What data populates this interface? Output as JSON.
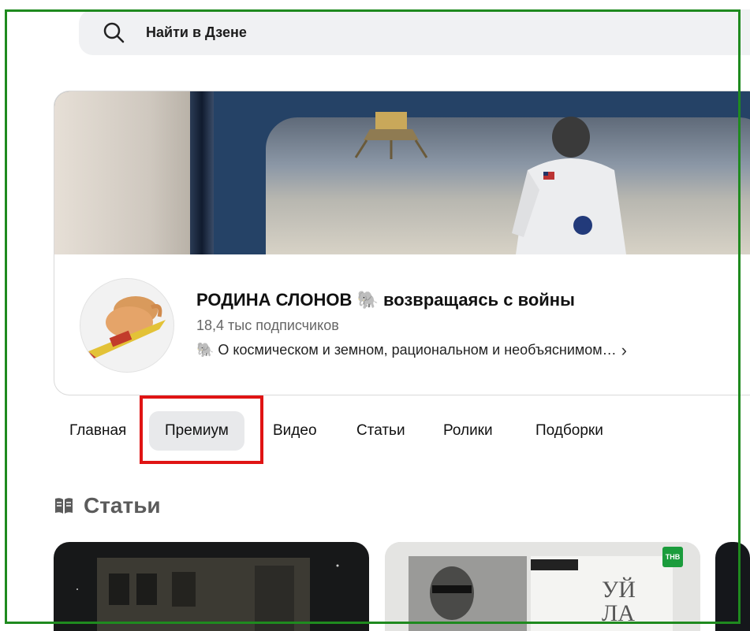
{
  "search": {
    "placeholder": "Найти в Дзене",
    "icon": "search-icon"
  },
  "channel": {
    "name": "РОДИНА СЛОНОВ 🐘 возвращаясь с войны",
    "subscribers": "18,4 тыс подписчиков",
    "description": "🐘 О космическом и земном, рациональном и необъяснимом…",
    "chevron": "›"
  },
  "tabs": [
    {
      "label": "Главная",
      "active": false
    },
    {
      "label": "Премиум",
      "active": true
    },
    {
      "label": "Видео",
      "active": false
    },
    {
      "label": "Статьи",
      "active": false
    },
    {
      "label": "Ролики",
      "active": false
    },
    {
      "label": "Подборки",
      "active": false
    }
  ],
  "section": {
    "title": "Статьи",
    "icon": "book-open-icon"
  },
  "thumbnails": {
    "second_badge": "ТНВ"
  },
  "colors": {
    "highlight_red": "#e01414",
    "frame_green": "#1f8a1f",
    "active_tab_bg": "#e8e9eb"
  }
}
